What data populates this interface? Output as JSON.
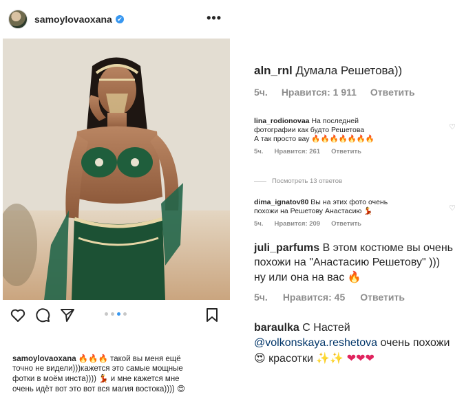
{
  "post": {
    "username": "samoylovaoxana",
    "verified_mark": "✔",
    "more_label": "•••",
    "carousel": {
      "count": 4,
      "active_index": 2
    },
    "caption": {
      "author": "samoylovaoxana",
      "line1": "такой вы меня ещё",
      "line2": "точно не видели)))кажется это самые мощные",
      "line3": "фотки в моём инста))))",
      "line3b": "и мне кажется мне",
      "line4": "очень идёт вот это вот вся магия востока))))"
    }
  },
  "comments": {
    "c1": {
      "author": "aln_rnl",
      "text": "Думала Решетова))",
      "time": "5ч.",
      "likes": "Нравится: 1 911",
      "reply": "Ответить"
    },
    "c2": {
      "author": "lina_rodionovaa",
      "line1": "На последней",
      "line2": "фотографии как будто Решетова",
      "line3": "А так просто вау",
      "time": "5ч.",
      "likes": "Нравится: 261",
      "reply": "Ответить",
      "view_replies": "Посмотреть 13 ответов"
    },
    "c3": {
      "author": "dima_ignatov80",
      "line1": "Вы на этих фото очень",
      "line2": "похожи на Решетову Анастасию",
      "time": "5ч.",
      "likes": "Нравится: 209",
      "reply": "Ответить"
    },
    "c4": {
      "author": "juli_parfums",
      "line1": "В этом костюме вы очень",
      "line2": "похожи на \"Анастасию Решетову\" )))",
      "line3": "ну или она на вас",
      "time": "5ч.",
      "likes": "Нравится: 45",
      "reply": "Ответить"
    },
    "c5": {
      "author": "baraulka",
      "line1": "С Настей",
      "mention": "@volkonskaya.reshetova",
      "line2_rest": "очень похожи",
      "line3": "красотки"
    }
  },
  "icons": {
    "like": "heart-outline-icon",
    "comment": "speech-bubble-icon",
    "share": "paper-plane-icon",
    "save": "bookmark-icon",
    "fire": "fire-emoji",
    "red_heart": "red-heart-emoji"
  },
  "colors": {
    "verified": "#3897f0",
    "secondary_text": "#8e8e8e",
    "mention": "#003569",
    "carousel_active": "#3897f0"
  }
}
